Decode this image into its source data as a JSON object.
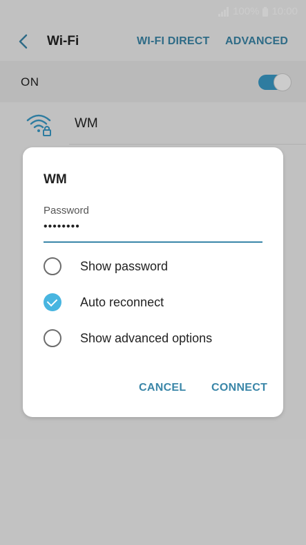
{
  "status_bar": {
    "battery": "100%",
    "time": "10:00"
  },
  "action_bar": {
    "title": "Wi-Fi",
    "wifi_direct": "WI-FI DIRECT",
    "advanced": "ADVANCED"
  },
  "toggle_row": {
    "label": "ON",
    "enabled": true
  },
  "network": {
    "name": "WM"
  },
  "dialog": {
    "title": "WM",
    "password_label": "Password",
    "password_value": "••••••••",
    "options": [
      {
        "label": "Show password",
        "checked": false
      },
      {
        "label": "Auto reconnect",
        "checked": true
      },
      {
        "label": "Show advanced options",
        "checked": false
      }
    ],
    "cancel": "CANCEL",
    "connect": "CONNECT"
  },
  "colors": {
    "accent": "#3a86a8",
    "check": "#48b5e0",
    "toggle": "#3a9bc8"
  }
}
